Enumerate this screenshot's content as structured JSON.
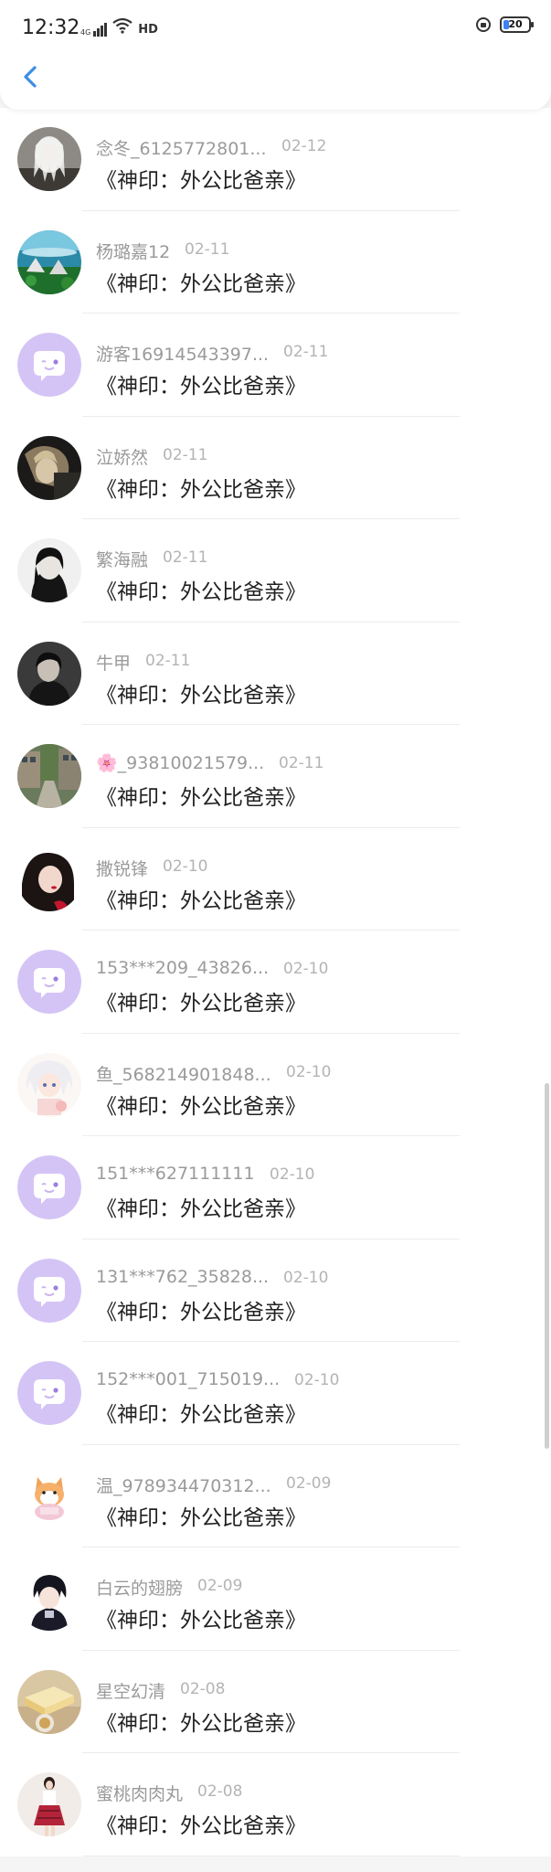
{
  "status_bar": {
    "time": "12:32",
    "network": "4G",
    "hd": "HD",
    "battery": "20",
    "battery_level": 0.2
  },
  "comments": [
    {
      "user": "念冬_6125772801...",
      "date": "02-12",
      "text": "《神印：外公比爸亲》",
      "avatar": "photo-silver-hair"
    },
    {
      "user": "杨璐嘉12",
      "date": "02-11",
      "text": "《神印：外公比爸亲》",
      "avatar": "photo-landscape"
    },
    {
      "user": "游客16914543397...",
      "date": "02-11",
      "text": "《神印：外公比爸亲》",
      "avatar": "default-chat"
    },
    {
      "user": "泣娇然",
      "date": "02-11",
      "text": "《神印：外公比爸亲》",
      "avatar": "photo-dark-portrait"
    },
    {
      "user": "繁海融",
      "date": "02-11",
      "text": "《神印：外公比爸亲》",
      "avatar": "photo-girl-bw"
    },
    {
      "user": "牛甲",
      "date": "02-11",
      "text": "《神印：外公比爸亲》",
      "avatar": "photo-boy-dark"
    },
    {
      "user": "🌸_93810021579...",
      "date": "02-11",
      "text": "《神印：外公比爸亲》",
      "avatar": "photo-street"
    },
    {
      "user": "撒锐锋",
      "date": "02-10",
      "text": "《神印：外公比爸亲》",
      "avatar": "photo-girl-red"
    },
    {
      "user": "153***209_43826...",
      "date": "02-10",
      "text": "《神印：外公比爸亲》",
      "avatar": "default-chat"
    },
    {
      "user": "鱼_568214901848...",
      "date": "02-10",
      "text": "《神印：外公比爸亲》",
      "avatar": "photo-anime-white"
    },
    {
      "user": "151***627111111",
      "date": "02-10",
      "text": "《神印：外公比爸亲》",
      "avatar": "default-chat"
    },
    {
      "user": "131***762_35828...",
      "date": "02-10",
      "text": "《神印：外公比爸亲》",
      "avatar": "default-chat"
    },
    {
      "user": "152***001_715019...",
      "date": "02-10",
      "text": "《神印：外公比爸亲》",
      "avatar": "default-chat"
    },
    {
      "user": "温_978934470312...",
      "date": "02-09",
      "text": "《神印：外公比爸亲》",
      "avatar": "photo-cat-cartoon"
    },
    {
      "user": "白云的翅膀",
      "date": "02-09",
      "text": "《神印：外公比爸亲》",
      "avatar": "photo-anime-boy"
    },
    {
      "user": "星空幻清",
      "date": "02-08",
      "text": "《神印：外公比爸亲》",
      "avatar": "photo-cake"
    },
    {
      "user": "蜜桃肉肉丸",
      "date": "02-08",
      "text": "《神印：外公比爸亲》",
      "avatar": "photo-girl-uniform"
    }
  ]
}
